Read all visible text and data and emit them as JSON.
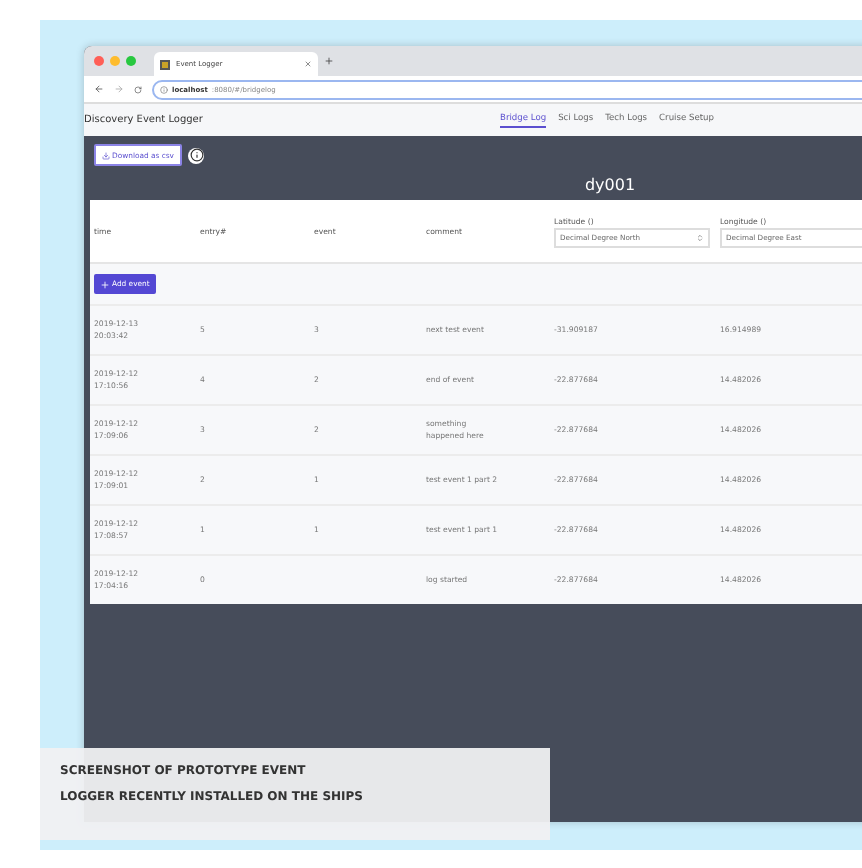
{
  "browser": {
    "tab_title": "Event Logger",
    "url_host": "localhost",
    "url_path": ":8080/#/bridgelog"
  },
  "app": {
    "title": "Discovery Event Logger",
    "nav": [
      {
        "label": "Bridge Log",
        "selected": true
      },
      {
        "label": "Sci Logs",
        "selected": false
      },
      {
        "label": "Tech Logs",
        "selected": false
      },
      {
        "label": "Cruise Setup",
        "selected": false
      }
    ]
  },
  "toolbar": {
    "download": "Download as csv",
    "cruise": "dy001"
  },
  "table": {
    "columns": [
      {
        "label": "time"
      },
      {
        "label": "entry#"
      },
      {
        "label": "event"
      },
      {
        "label": "comment"
      },
      {
        "label": "Latitude ()",
        "select": "Decimal Degree North"
      },
      {
        "label": "Longitude ()",
        "select": "Decimal Degree East"
      }
    ],
    "add_button": "Add event",
    "rows": [
      [
        "2019-12-13\n20:03:42",
        "5",
        "3",
        "next test event",
        "-31.909187",
        "16.914989"
      ],
      [
        "2019-12-12\n17:10:56",
        "4",
        "2",
        "end of event",
        "-22.877684",
        "14.482026"
      ],
      [
        "2019-12-12\n17:09:06",
        "3",
        "2",
        "something\nhappened here",
        "-22.877684",
        "14.482026"
      ],
      [
        "2019-12-12\n17:09:01",
        "2",
        "1",
        "test event 1 part 2",
        "-22.877684",
        "14.482026"
      ],
      [
        "2019-12-12\n17:08:57",
        "1",
        "1",
        "test event 1 part 1",
        "-22.877684",
        "14.482026"
      ],
      [
        "2019-12-12\n17:04:16",
        "0",
        "",
        "log started",
        "-22.877684",
        "14.482026"
      ]
    ]
  },
  "caption": "SCREENSHOT OF PROTOTYPE EVENT\nLOGGER RECENTLY INSTALLED ON THE SHIPS"
}
